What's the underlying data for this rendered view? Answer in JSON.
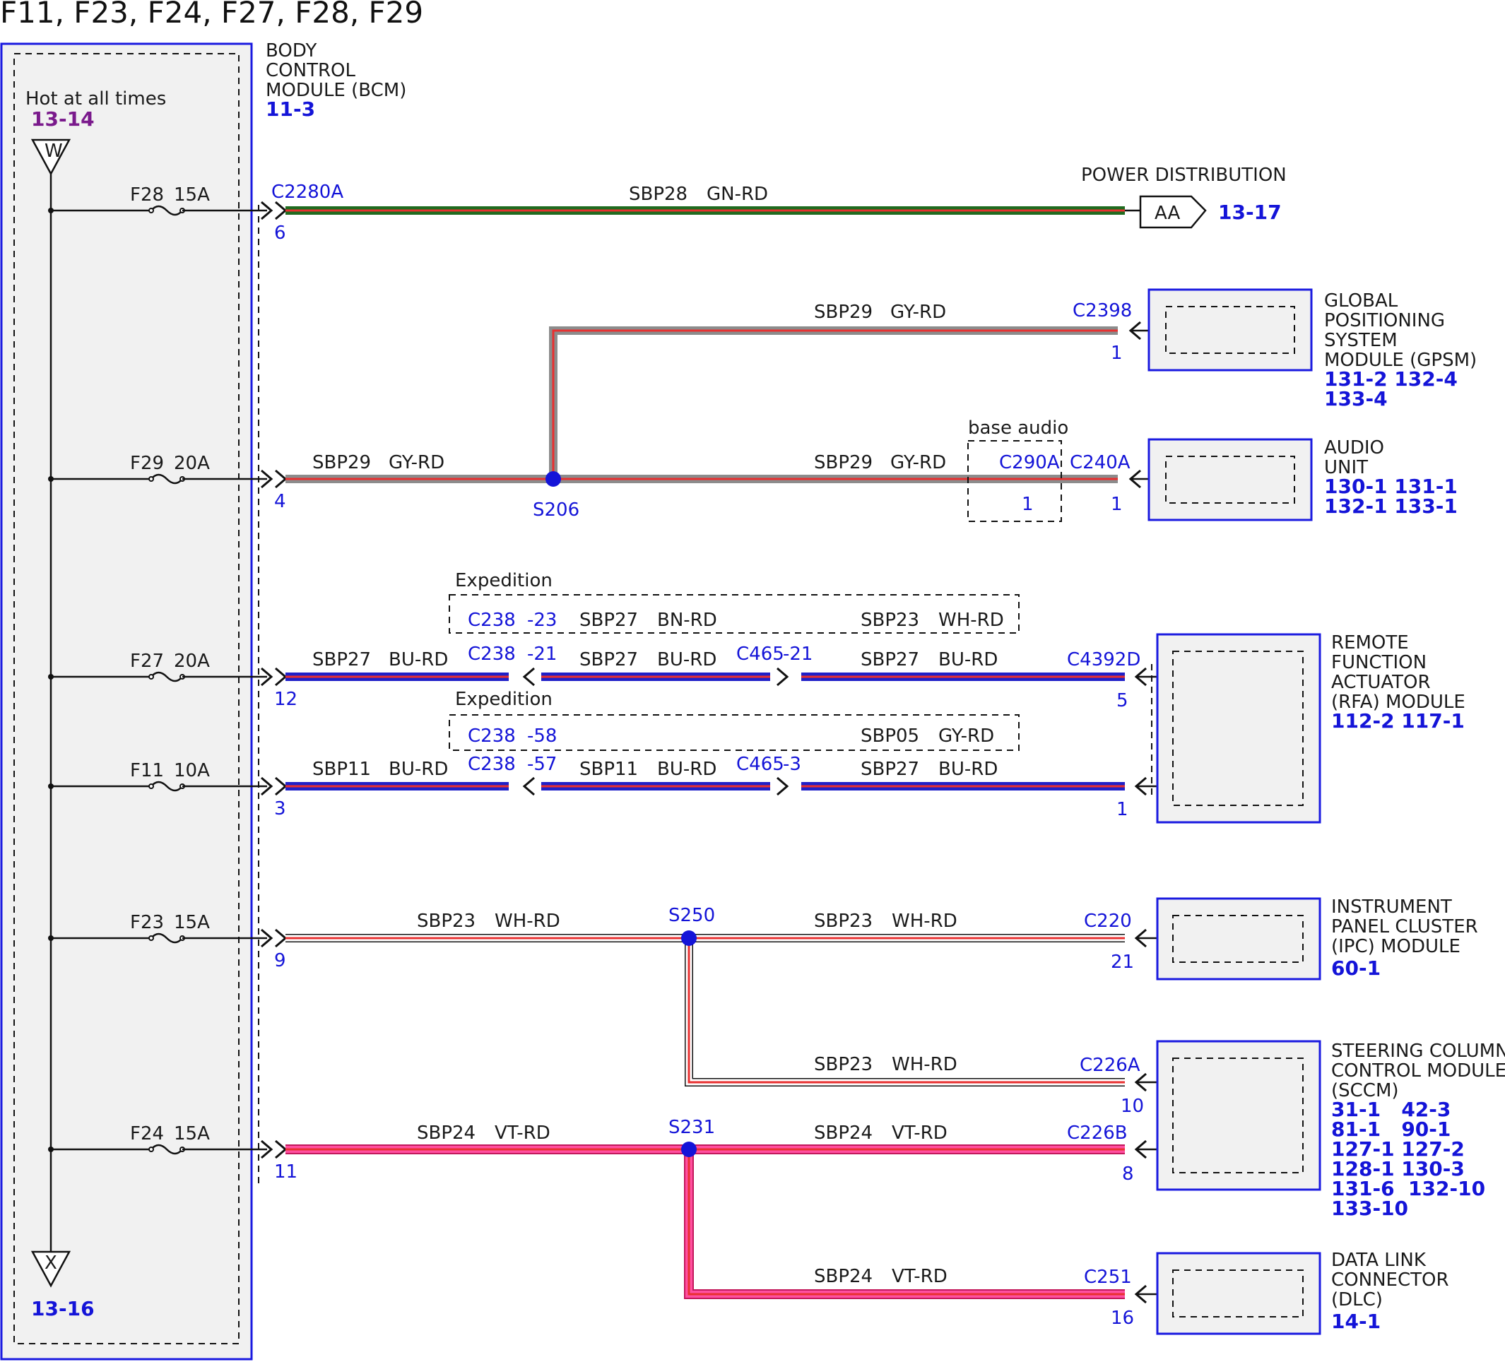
{
  "title": "F11, F23, F24, F27, F28, F29",
  "bcm": {
    "name_lines": [
      "BODY",
      "CONTROL",
      "MODULE (BCM)"
    ],
    "ref": "11-3",
    "hot_label": "Hot at all times",
    "hot_ref": "13-14",
    "top_terminal": "W",
    "bottom_terminal": "X",
    "bottom_ref": "13-16"
  },
  "fuses": [
    {
      "id": "F28",
      "amps": "15A",
      "pin": "6"
    },
    {
      "id": "F29",
      "amps": "20A",
      "pin": "4"
    },
    {
      "id": "F27",
      "amps": "20A",
      "pin": "12"
    },
    {
      "id": "F11",
      "amps": "10A",
      "pin": "3"
    },
    {
      "id": "F23",
      "amps": "15A",
      "pin": "9"
    },
    {
      "id": "F24",
      "amps": "15A",
      "pin": "11"
    }
  ],
  "bcm_connector": "C2280A",
  "circuits": {
    "sbp28": {
      "name": "SBP28",
      "color": "GN-RD"
    },
    "sbp29": {
      "name": "SBP29",
      "color": "GY-RD"
    },
    "sbp27": {
      "name": "SBP27",
      "color": "BU-RD"
    },
    "sbp11": {
      "name": "SBP11",
      "color": "BU-RD"
    },
    "sbp23": {
      "name": "SBP23",
      "color": "WH-RD"
    },
    "sbp24": {
      "name": "SBP24",
      "color": "VT-RD"
    },
    "sbp23_exp": {
      "name": "SBP23",
      "color": "WH-RD"
    },
    "sbp05_exp": {
      "name": "SBP05",
      "color": "GY-RD"
    },
    "sbp27_exp": {
      "name": "SBP27",
      "color": "BN-RD"
    }
  },
  "power_distribution": {
    "label": "POWER DISTRIBUTION",
    "tag": "AA",
    "ref": "13-17"
  },
  "splices": {
    "s206": "S206",
    "s250": "S250",
    "s231": "S231"
  },
  "base_audio": {
    "label": "base audio",
    "connector": "C290A",
    "pin": "1"
  },
  "expedition_label": "Expedition",
  "c238": {
    "name": "C238",
    "pin_23": "-23",
    "pin_21": "-21",
    "pin_58": "-58",
    "pin_57": "-57"
  },
  "c465": {
    "name": "C465",
    "pin_21": "-21",
    "pin_3": "-3"
  },
  "modules": {
    "gpsm": {
      "connector": "C2398",
      "pin": "1",
      "name_lines": [
        "GLOBAL",
        "POSITIONING",
        "SYSTEM",
        "MODULE (GPSM)"
      ],
      "refs": [
        "131-2 132-4",
        "133-4"
      ]
    },
    "audio": {
      "connector": "C240A",
      "pin": "1",
      "name_lines": [
        "AUDIO",
        "UNIT"
      ],
      "refs": [
        "130-1 131-1",
        "132-1 133-1"
      ]
    },
    "rfa": {
      "connector": "C4392D",
      "pin_a": "5",
      "pin_b": "1",
      "name_lines": [
        "REMOTE",
        "FUNCTION",
        "ACTUATOR",
        "(RFA) MODULE"
      ],
      "refs": [
        "112-2 117-1"
      ]
    },
    "ipc": {
      "connector": "C220",
      "pin": "21",
      "name_lines": [
        "INSTRUMENT",
        "PANEL CLUSTER",
        "(IPC) MODULE"
      ],
      "refs": [
        "60-1"
      ]
    },
    "sccm": {
      "connector_a": "C226A",
      "pin_a": "10",
      "connector_b": "C226B",
      "pin_b": "8",
      "name_lines": [
        "STEERING COLUMN",
        "CONTROL MODULE",
        "(SCCM)"
      ],
      "refs": [
        "31-1   42-3",
        "81-1   90-1",
        "127-1 127-2",
        "128-1 130-3",
        "131-6  132-10",
        "133-10"
      ]
    },
    "dlc": {
      "connector": "C251",
      "pin": "16",
      "name_lines": [
        "DATA LINK",
        "CONNECTOR",
        "(DLC)"
      ],
      "refs": [
        "14-1"
      ]
    }
  },
  "wire_colors": {
    "gn": "#1f6b1f",
    "rd": "#e83030",
    "gy": "#8c8c8c",
    "bu": "#2020c8",
    "wh": "#ffffff",
    "vt": "#ff4fa0",
    "connector_blue": "#1414d8",
    "ref_purple": "#7a1a8c"
  }
}
